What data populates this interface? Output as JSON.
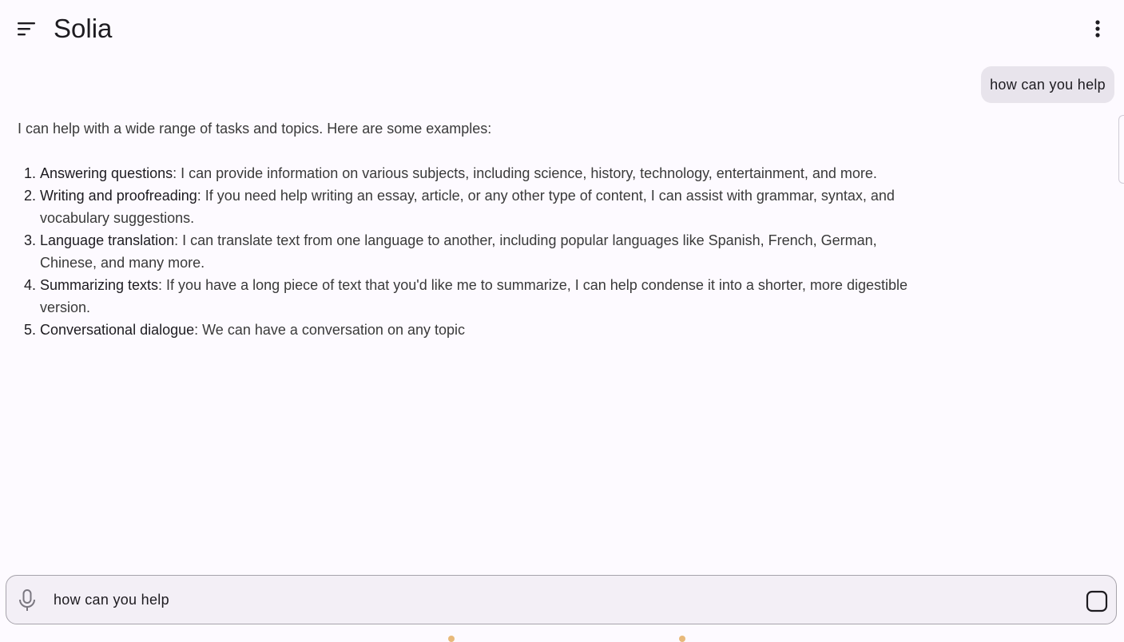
{
  "header": {
    "title": "Solia",
    "menu_icon": "sort-menu-icon",
    "more_icon": "more-vert-icon"
  },
  "conversation": {
    "user_message": "how can you help",
    "reply": {
      "intro": "I can help with a wide range of tasks and topics. Here are some examples:",
      "items": [
        {
          "term": "Answering questions",
          "text": ": I can provide information on various subjects, including science, history, technology, entertainment, and more."
        },
        {
          "term": "Writing and proofreading",
          "text": ": If you need help writing an essay, article, or any other type of content, I can assist with grammar, syntax, and vocabulary suggestions."
        },
        {
          "term": "Language translation",
          "text": ": I can translate text from one language to another, including popular languages like Spanish, French, German, Chinese, and many more."
        },
        {
          "term": "Summarizing texts",
          "text": ": If you have a long piece of text that you'd like me to summarize, I can help condense it into a shorter, more digestible version."
        },
        {
          "term": "Conversational dialogue",
          "text": ": We can have a conversation on any topic"
        }
      ]
    }
  },
  "composer": {
    "value": "how can you help",
    "mic_icon": "microphone-icon",
    "stop_icon": "stop-icon"
  },
  "colors": {
    "background": "#fdfaff",
    "user_bubble": "#e8e4ec",
    "composer_bg": "#f3eff6",
    "composer_border": "#a6a3ab"
  }
}
